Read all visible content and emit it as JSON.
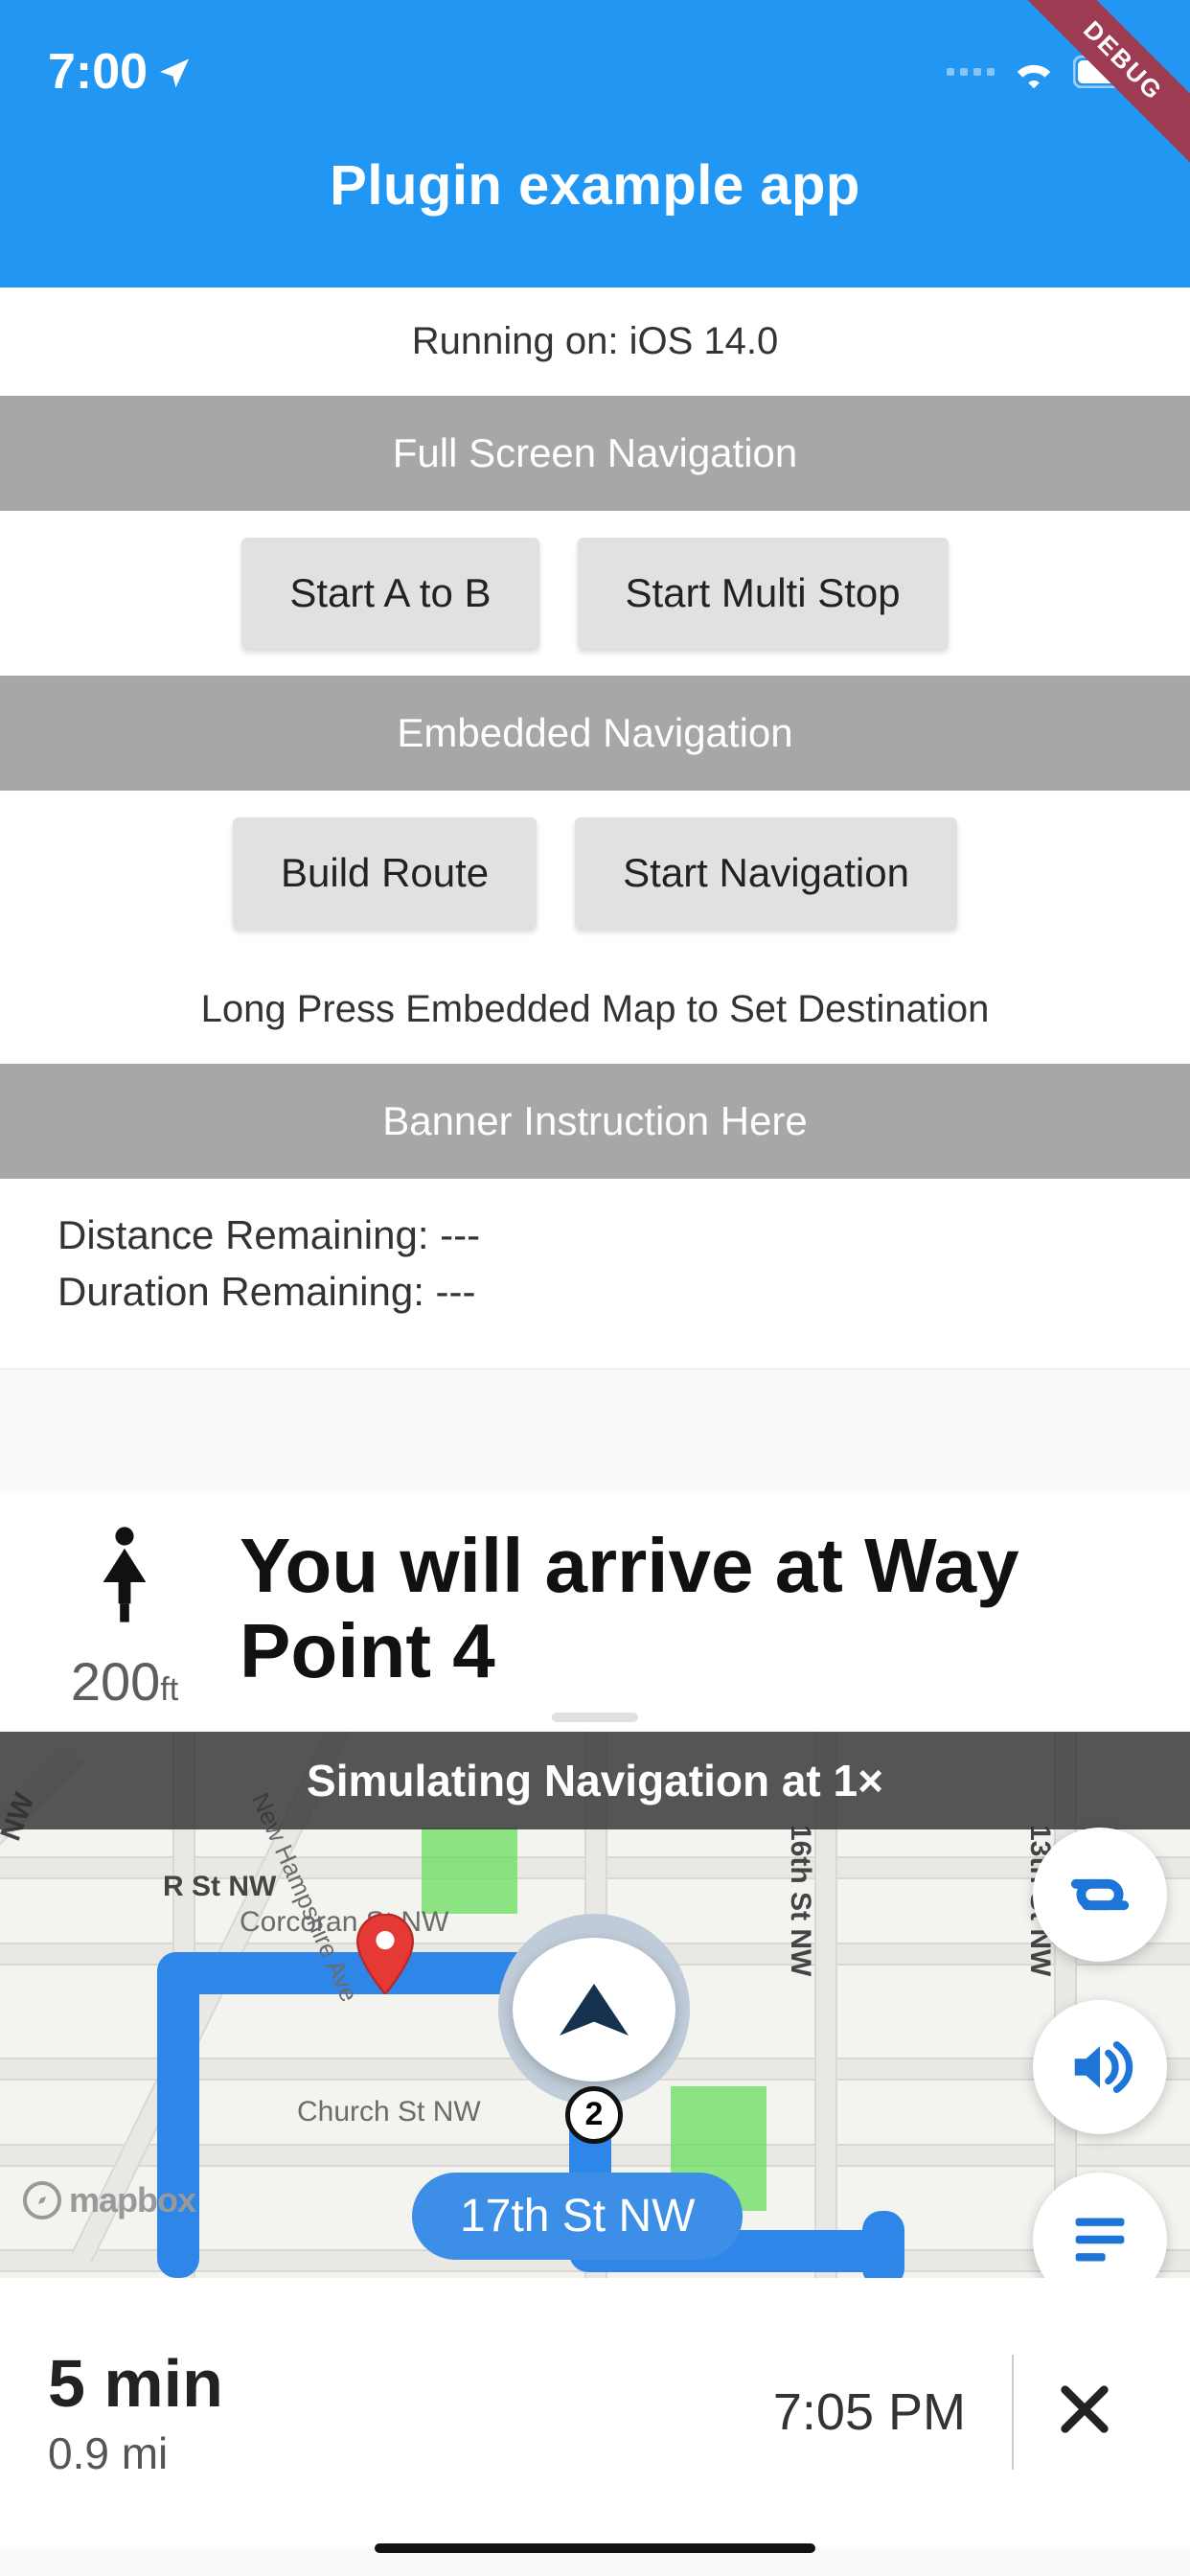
{
  "statusbar": {
    "time": "7:00"
  },
  "debug_ribbon": "DEBUG",
  "appbar": {
    "title": "Plugin example app"
  },
  "running_on": "Running on: iOS 14.0",
  "sections": {
    "fullscreen": {
      "title": "Full Screen Navigation",
      "btn_a_to_b": "Start A to B",
      "btn_multi": "Start Multi Stop"
    },
    "embedded": {
      "title": "Embedded Navigation",
      "btn_build": "Build Route",
      "btn_start": "Start Navigation",
      "hint": "Long Press Embedded Map to Set Destination"
    },
    "banner": {
      "title": "Banner Instruction Here"
    }
  },
  "stats": {
    "distance_line": "Distance Remaining: ---",
    "duration_line": "Duration Remaining: ---"
  },
  "arrival": {
    "distance": "200",
    "unit": "ft",
    "message": "You will arrive at Way Point 4"
  },
  "map": {
    "sim_label": "Simulating Navigation at 1×",
    "streets": {
      "r_st": "R St NW",
      "corcoran": "Corcoran St NW",
      "church": "Church St NW",
      "new_hampshire": "New Hampshire Ave",
      "sixteenth": "16th St NW",
      "thirteenth": "13th St NW",
      "nw_diag": "NW"
    },
    "route_chip": "17th St NW",
    "waypoint_number": "2",
    "mapbox": "mapbox"
  },
  "bottom": {
    "eta": "5 min",
    "distance": "0.9 mi",
    "arrival_time": "7:05 PM"
  },
  "icons": {
    "route_alt": "route-alt-icon",
    "volume": "volume-icon",
    "list": "list-icon"
  },
  "colors": {
    "primary": "#2196f3",
    "route": "#2e86e8",
    "ribbon": "#9d3b52"
  }
}
